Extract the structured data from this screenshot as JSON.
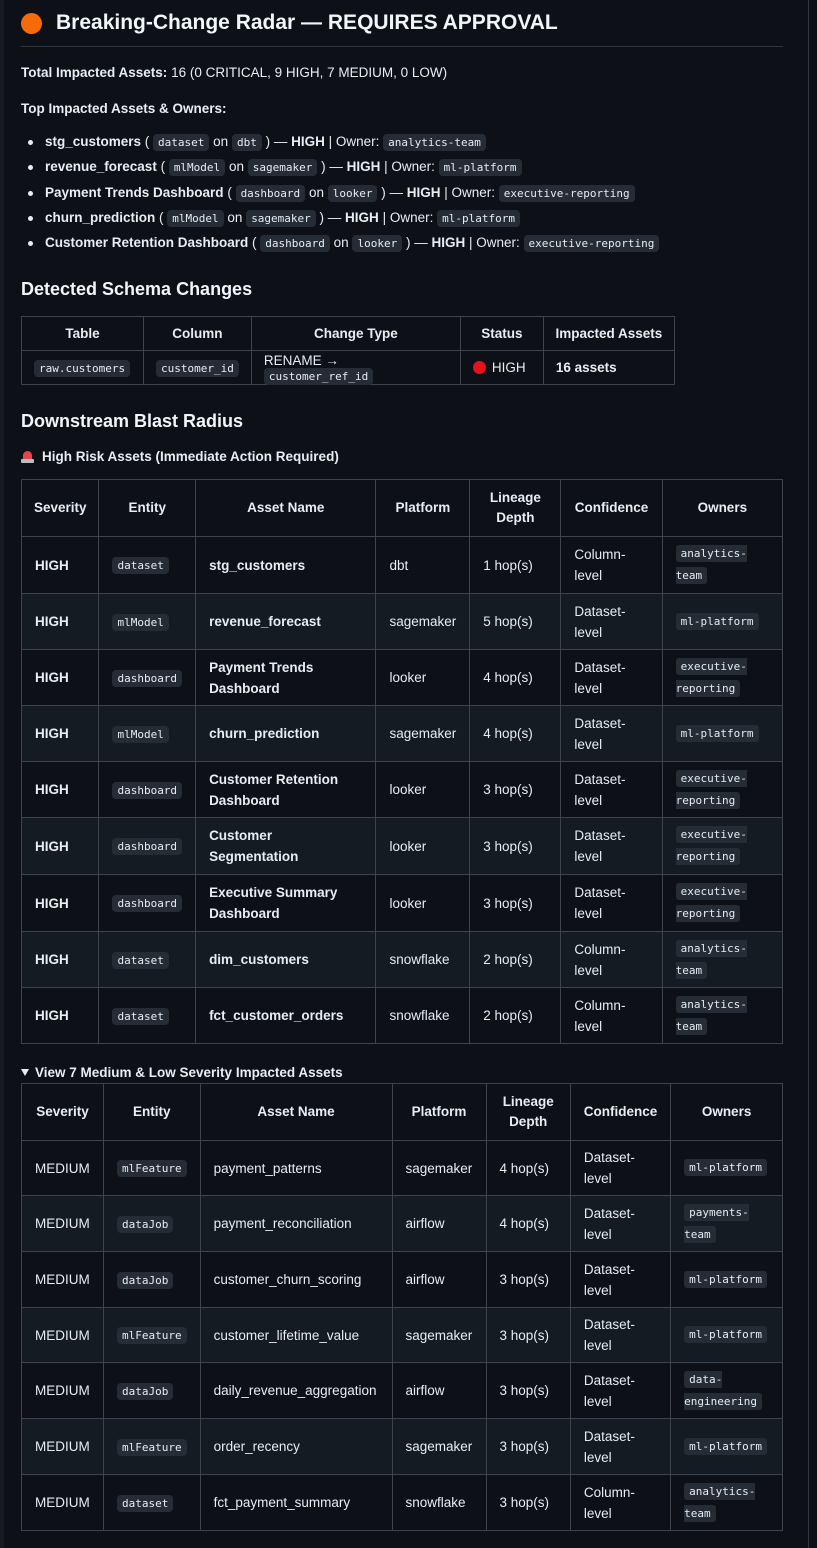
{
  "header": {
    "title": "Breaking-Change Radar — REQUIRES APPROVAL",
    "status_color": "#f66a0a"
  },
  "summary": {
    "label": "Total Impacted Assets:",
    "value": "16 (0 CRITICAL, 9 HIGH, 7 MEDIUM, 0 LOW)"
  },
  "top_assets": {
    "heading": "Top Impacted Assets & Owners:",
    "items": [
      {
        "name": "stg_customers",
        "type": "dataset",
        "platform": "dbt",
        "severity": "HIGH",
        "owner": "analytics-team"
      },
      {
        "name": "revenue_forecast",
        "type": "mlModel",
        "platform": "sagemaker",
        "severity": "HIGH",
        "owner": "ml-platform"
      },
      {
        "name": "Payment Trends Dashboard",
        "type": "dashboard",
        "platform": "looker",
        "severity": "HIGH",
        "owner": "executive-reporting"
      },
      {
        "name": "churn_prediction",
        "type": "mlModel",
        "platform": "sagemaker",
        "severity": "HIGH",
        "owner": "ml-platform"
      },
      {
        "name": "Customer Retention Dashboard",
        "type": "dashboard",
        "platform": "looker",
        "severity": "HIGH",
        "owner": "executive-reporting"
      }
    ],
    "on_text": "on",
    "owner_label": "| Owner:"
  },
  "schema_changes": {
    "heading": "Detected Schema Changes",
    "columns": [
      "Table",
      "Column",
      "Change Type",
      "Status",
      "Impacted Assets"
    ],
    "row": {
      "table": "raw.customers",
      "column": "customer_id",
      "change_prefix": "RENAME →",
      "change_target": "customer_ref_id",
      "status": "HIGH",
      "impacted": "16 assets"
    }
  },
  "blast": {
    "heading": "Downstream Blast Radius",
    "high_risk_heading": "High Risk Assets (Immediate Action Required)",
    "columns": [
      "Severity",
      "Entity",
      "Asset Name",
      "Platform",
      "Lineage Depth",
      "Confidence",
      "Owners"
    ],
    "high_rows": [
      {
        "severity": "HIGH",
        "entity": "dataset",
        "name": "stg_customers",
        "platform": "dbt",
        "depth": "1 hop(s)",
        "confidence": "Column-level",
        "owners": "analytics-team"
      },
      {
        "severity": "HIGH",
        "entity": "mlModel",
        "name": "revenue_forecast",
        "platform": "sagemaker",
        "depth": "5 hop(s)",
        "confidence": "Dataset-level",
        "owners": "ml-platform"
      },
      {
        "severity": "HIGH",
        "entity": "dashboard",
        "name": "Payment Trends Dashboard",
        "platform": "looker",
        "depth": "4 hop(s)",
        "confidence": "Dataset-level",
        "owners": "executive-reporting"
      },
      {
        "severity": "HIGH",
        "entity": "mlModel",
        "name": "churn_prediction",
        "platform": "sagemaker",
        "depth": "4 hop(s)",
        "confidence": "Dataset-level",
        "owners": "ml-platform"
      },
      {
        "severity": "HIGH",
        "entity": "dashboard",
        "name": "Customer Retention Dashboard",
        "platform": "looker",
        "depth": "3 hop(s)",
        "confidence": "Dataset-level",
        "owners": "executive-reporting"
      },
      {
        "severity": "HIGH",
        "entity": "dashboard",
        "name": "Customer Segmentation",
        "platform": "looker",
        "depth": "3 hop(s)",
        "confidence": "Dataset-level",
        "owners": "executive-reporting"
      },
      {
        "severity": "HIGH",
        "entity": "dashboard",
        "name": "Executive Summary Dashboard",
        "platform": "looker",
        "depth": "3 hop(s)",
        "confidence": "Dataset-level",
        "owners": "executive-reporting"
      },
      {
        "severity": "HIGH",
        "entity": "dataset",
        "name": "dim_customers",
        "platform": "snowflake",
        "depth": "2 hop(s)",
        "confidence": "Column-level",
        "owners": "analytics-team"
      },
      {
        "severity": "HIGH",
        "entity": "dataset",
        "name": "fct_customer_orders",
        "platform": "snowflake",
        "depth": "2 hop(s)",
        "confidence": "Column-level",
        "owners": "analytics-team"
      }
    ],
    "medium_heading": "View 7 Medium & Low Severity Impacted Assets",
    "medium_rows": [
      {
        "severity": "MEDIUM",
        "entity": "mlFeature",
        "name": "payment_patterns",
        "platform": "sagemaker",
        "depth": "4 hop(s)",
        "confidence": "Dataset-level",
        "owners": "ml-platform"
      },
      {
        "severity": "MEDIUM",
        "entity": "dataJob",
        "name": "payment_reconciliation",
        "platform": "airflow",
        "depth": "4 hop(s)",
        "confidence": "Dataset-level",
        "owners": "payments-team"
      },
      {
        "severity": "MEDIUM",
        "entity": "dataJob",
        "name": "customer_churn_scoring",
        "platform": "airflow",
        "depth": "3 hop(s)",
        "confidence": "Dataset-level",
        "owners": "ml-platform"
      },
      {
        "severity": "MEDIUM",
        "entity": "mlFeature",
        "name": "customer_lifetime_value",
        "platform": "sagemaker",
        "depth": "3 hop(s)",
        "confidence": "Dataset-level",
        "owners": "ml-platform"
      },
      {
        "severity": "MEDIUM",
        "entity": "dataJob",
        "name": "daily_revenue_aggregation",
        "platform": "airflow",
        "depth": "3 hop(s)",
        "confidence": "Dataset-level",
        "owners": "data-engineering"
      },
      {
        "severity": "MEDIUM",
        "entity": "mlFeature",
        "name": "order_recency",
        "platform": "sagemaker",
        "depth": "3 hop(s)",
        "confidence": "Dataset-level",
        "owners": "ml-platform"
      },
      {
        "severity": "MEDIUM",
        "entity": "dataset",
        "name": "fct_payment_summary",
        "platform": "snowflake",
        "depth": "3 hop(s)",
        "confidence": "Column-level",
        "owners": "analytics-team"
      }
    ]
  }
}
